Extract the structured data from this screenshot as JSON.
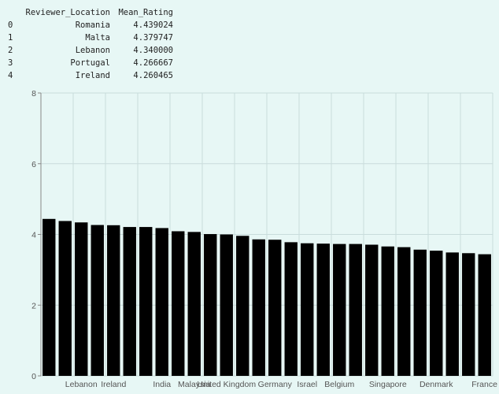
{
  "table": {
    "headers": [
      "",
      "Reviewer_Location",
      "Mean_Rating"
    ],
    "rows": [
      [
        "0",
        "Romania",
        "4.439024"
      ],
      [
        "1",
        "Malta",
        "4.379747"
      ],
      [
        "2",
        "Lebanon",
        "4.340000"
      ],
      [
        "3",
        "Portugal",
        "4.266667"
      ],
      [
        "4",
        "Ireland",
        "4.260465"
      ]
    ]
  },
  "chart_data": {
    "type": "bar",
    "title": "",
    "xlabel": "",
    "ylabel": "",
    "ylim": [
      0,
      8
    ],
    "yticks": [
      0,
      2,
      4,
      6,
      8
    ],
    "grid": true,
    "bar_color": "#000000",
    "background": "#e7f7f5",
    "grid_color": "#c9dcdc",
    "categories": [
      "Romania",
      "Malta",
      "Lebanon",
      "Portugal",
      "Ireland",
      "",
      "",
      "India",
      "",
      "Malaysia",
      "",
      "United Kingdom",
      "",
      "",
      "Germany",
      "",
      "Israel",
      "",
      "Belgium",
      "",
      "",
      "Singapore",
      "",
      "",
      "Denmark",
      "",
      "",
      "France"
    ],
    "visible_tick_labels": [
      "Lebanon",
      "Ireland",
      "India",
      "Malaysia",
      "United Kingdom",
      "Germany",
      "Israel",
      "Belgium",
      "Singapore",
      "Denmark",
      "France"
    ],
    "values": [
      4.439024,
      4.379747,
      4.34,
      4.266667,
      4.260465,
      4.21,
      4.21,
      4.18,
      4.09,
      4.07,
      4.01,
      4.0,
      3.96,
      3.86,
      3.85,
      3.78,
      3.75,
      3.74,
      3.73,
      3.73,
      3.71,
      3.66,
      3.64,
      3.57,
      3.54,
      3.49,
      3.47,
      3.44
    ]
  }
}
